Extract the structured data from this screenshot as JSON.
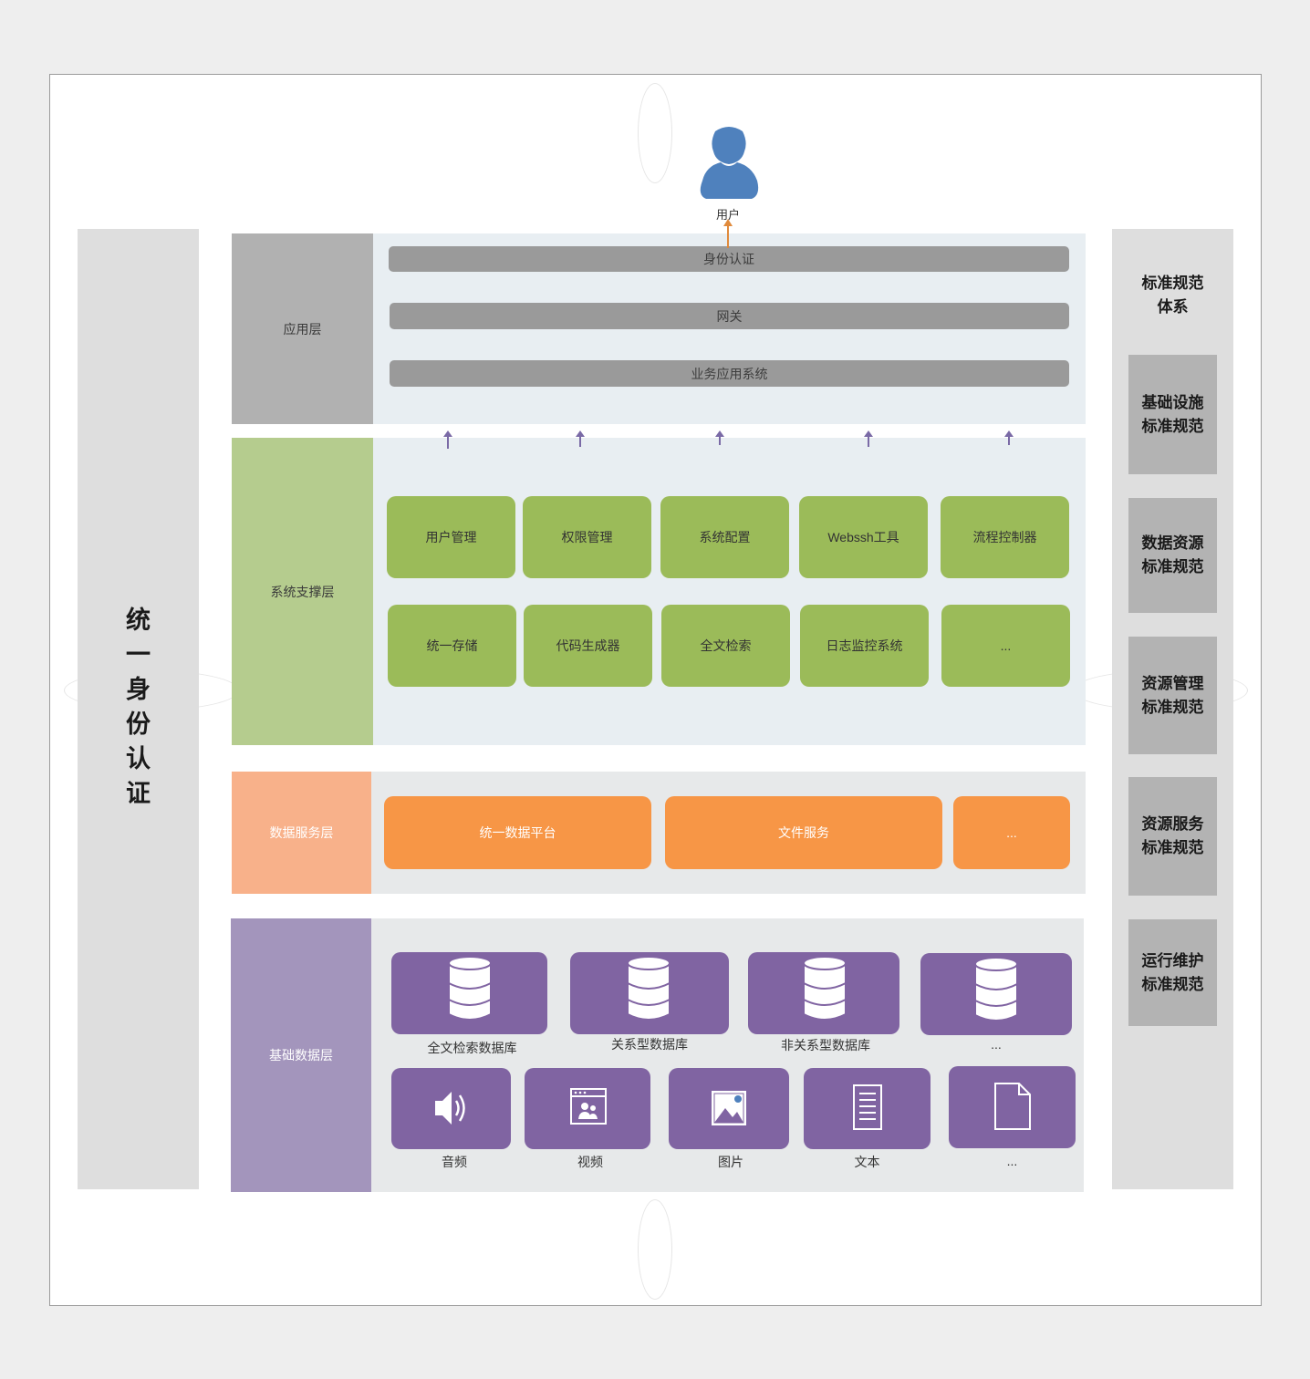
{
  "left_column": {
    "chars": [
      "统",
      "一",
      "身",
      "份",
      "认",
      "证"
    ]
  },
  "user": {
    "label": "用户"
  },
  "app_layer": {
    "label": "应用层",
    "bars": [
      "身份认证",
      "网关",
      "业务应用系统"
    ]
  },
  "support_layer": {
    "label": "系统支撑层",
    "row1": [
      "用户管理",
      "权限管理",
      "系统配置",
      "Webssh工具",
      "流程控制器"
    ],
    "row2": [
      "统一存储",
      "代码生成器",
      "全文检索",
      "日志监控系统",
      "..."
    ]
  },
  "data_service_layer": {
    "label": "数据服务层",
    "items": [
      "统一数据平台",
      "文件服务",
      "..."
    ]
  },
  "base_data_layer": {
    "label": "基础数据层",
    "databases": [
      {
        "label": "全文检索数据库",
        "icon": "database-icon"
      },
      {
        "label": "关系型数据库",
        "icon": "database-icon"
      },
      {
        "label": "非关系型数据库",
        "icon": "database-icon"
      },
      {
        "label": "...",
        "icon": "database-icon"
      }
    ],
    "media": [
      {
        "label": "音频",
        "icon": "audio-icon"
      },
      {
        "label": "视频",
        "icon": "video-icon"
      },
      {
        "label": "图片",
        "icon": "image-icon"
      },
      {
        "label": "文本",
        "icon": "text-document-icon"
      },
      {
        "label": "...",
        "icon": "file-icon"
      }
    ]
  },
  "standards": {
    "title": "标准规范\n体系",
    "items": [
      "基础设施\n标准规范",
      "数据资源\n标准规范",
      "资源管理\n标准规范",
      "资源服务\n标准规范",
      "运行维护\n标准规范"
    ]
  },
  "colors": {
    "user": "#4f81bd",
    "app_bar": "#9a9a9a",
    "support_box": "#9bbb59",
    "data_service_box": "#f79646",
    "base_box": "#8064a2",
    "arrow_user": "#e08a3c",
    "arrow_up": "#7a6aa6"
  }
}
